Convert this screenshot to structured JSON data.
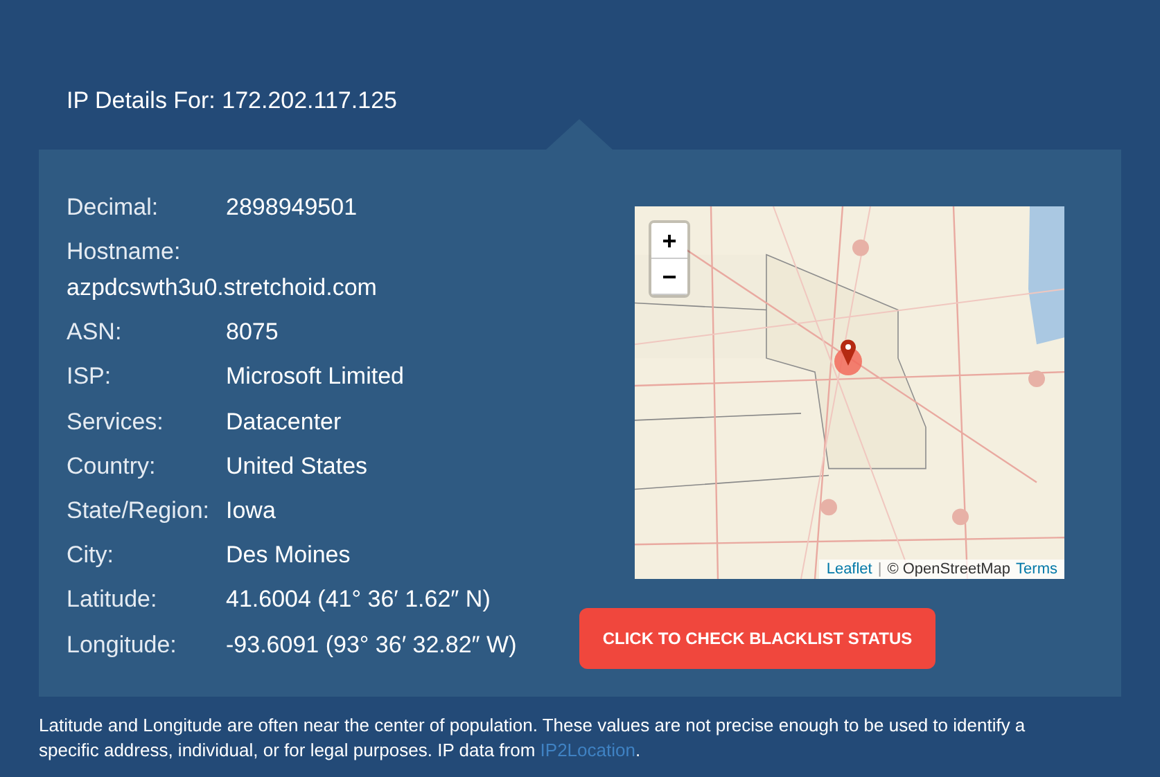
{
  "title": "IP Details For: 172.202.117.125",
  "details": [
    {
      "label": "Decimal:",
      "value": "2898949501",
      "kind": "inline"
    },
    {
      "label": "Hostname:",
      "value": "azpdcswth3u0.stretchoid.com",
      "kind": "stacked"
    },
    {
      "label": "ASN:",
      "value": "8075",
      "kind": "inline"
    },
    {
      "label": "ISP:",
      "value": "Microsoft Limited",
      "kind": "inline"
    },
    {
      "label": "Services:",
      "value": "Datacenter",
      "kind": "inline"
    },
    {
      "label": "Country:",
      "value": "United States",
      "kind": "inline"
    },
    {
      "label": "State/Region:",
      "value": "Iowa",
      "kind": "inline"
    },
    {
      "label": "City:",
      "value": "Des Moines",
      "kind": "inline"
    },
    {
      "label": "Latitude:",
      "value": "41.6004 (41° 36′ 1.62″ N)",
      "kind": "inline"
    },
    {
      "label": "Longitude:",
      "value": "-93.6091 (93° 36′ 32.82″ W)",
      "kind": "inline"
    }
  ],
  "map": {
    "zoom_in": "+",
    "zoom_out": "−",
    "attribution_link": "Leaflet",
    "attribution_separator": "|",
    "attribution_text": "© OpenStreetMap",
    "terms_link": "Terms"
  },
  "blacklist_button": "CLICK TO CHECK BLACKLIST STATUS",
  "footnote": {
    "text": "Latitude and Longitude are often near the center of population. These values are not precise enough to be used to identify a specific address, individual, or for legal purposes. IP data from ",
    "link": "IP2Location",
    "end": "."
  }
}
